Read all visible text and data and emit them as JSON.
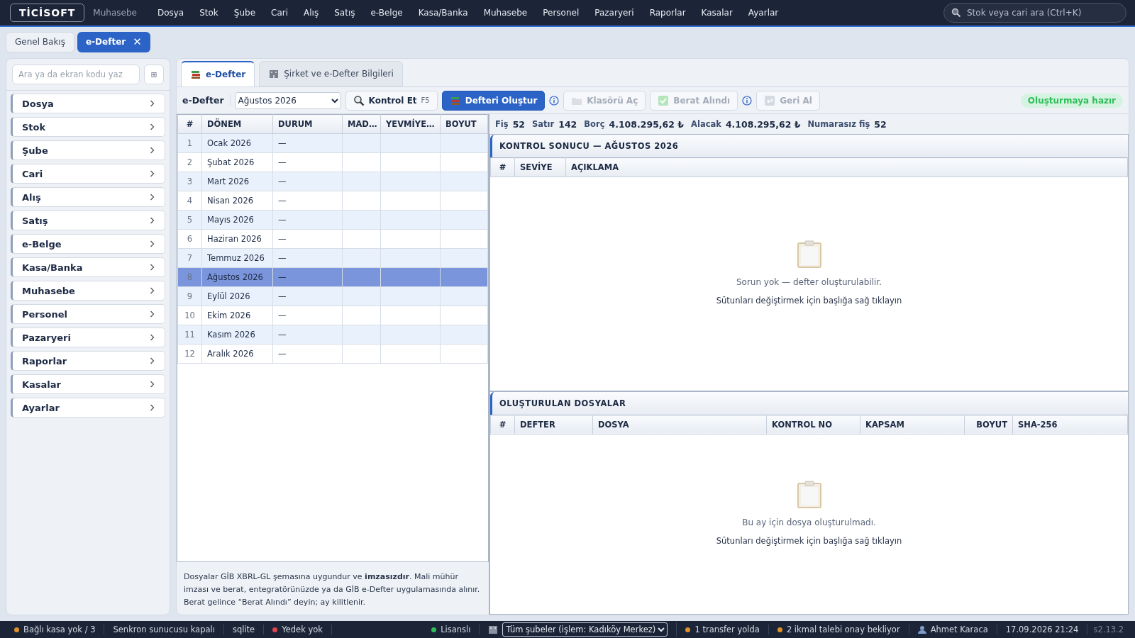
{
  "topbar": {
    "logo": "TİCİSOFT",
    "module": "Muhasebe",
    "menu": [
      "Dosya",
      "Stok",
      "Şube",
      "Cari",
      "Alış",
      "Satış",
      "e-Belge",
      "Kasa/Banka",
      "Muhasebe",
      "Personel",
      "Pazaryeri",
      "Raporlar",
      "Kasalar",
      "Ayarlar"
    ],
    "search": {
      "placeholder": "Stok veya cari ara (Ctrl+K)"
    }
  },
  "page_tabs": [
    {
      "label": "Genel Bakış",
      "selected": false
    },
    {
      "label": "e-Defter",
      "selected": true,
      "close": "✕"
    }
  ],
  "sidebar": {
    "search": {
      "placeholder": "Ara ya da ekran kodu yaz"
    },
    "grid_button": "⊞",
    "items": [
      "Dosya",
      "Stok",
      "Şube",
      "Cari",
      "Alış",
      "Satış",
      "e-Belge",
      "Kasa/Banka",
      "Muhasebe",
      "Personel",
      "Pazaryeri",
      "Raporlar",
      "Kasalar",
      "Ayarlar"
    ]
  },
  "inner_tabs": [
    {
      "label": "e-Defter",
      "selected": true
    },
    {
      "label": "Şirket ve e-Defter Bilgileri",
      "selected": false
    }
  ],
  "toolbar": {
    "title": "e-Defter",
    "period": "Ağustos 2026",
    "buttons": [
      {
        "label": "Kontrol Et",
        "shortcut": "F5",
        "kind": "normal",
        "disabled": false,
        "info": false
      },
      {
        "label": "Defteri Oluştur",
        "kind": "primary",
        "disabled": false,
        "info": true
      },
      {
        "label": "Klasörü Aç",
        "kind": "normal",
        "disabled": true,
        "info": false
      },
      {
        "label": "Berat Alındı",
        "kind": "normal",
        "disabled": true,
        "info": true
      },
      {
        "label": "Geri Al",
        "kind": "normal",
        "disabled": true,
        "info": false
      }
    ],
    "status": "Oluşturmaya hazır"
  },
  "periods_table": {
    "columns": [
      "#",
      "DÖNEM",
      "DURUM",
      "MAD…",
      "YEVMİYE…",
      "BOYUT"
    ],
    "rows": [
      {
        "no": "1",
        "period": "Ocak 2026",
        "status": "—",
        "selected": false
      },
      {
        "no": "2",
        "period": "Şubat 2026",
        "status": "—",
        "selected": false
      },
      {
        "no": "3",
        "period": "Mart 2026",
        "status": "—",
        "selected": false
      },
      {
        "no": "4",
        "period": "Nisan 2026",
        "status": "—",
        "selected": false
      },
      {
        "no": "5",
        "period": "Mayıs 2026",
        "status": "—",
        "selected": false
      },
      {
        "no": "6",
        "period": "Haziran 2026",
        "status": "—",
        "selected": false
      },
      {
        "no": "7",
        "period": "Temmuz 2026",
        "status": "—",
        "selected": false
      },
      {
        "no": "8",
        "period": "Ağustos 2026",
        "status": "—",
        "selected": true
      },
      {
        "no": "9",
        "period": "Eylül 2026",
        "status": "—",
        "selected": false
      },
      {
        "no": "10",
        "period": "Ekim 2026",
        "status": "—",
        "selected": false
      },
      {
        "no": "11",
        "period": "Kasım 2026",
        "status": "—",
        "selected": false
      },
      {
        "no": "12",
        "period": "Aralık 2026",
        "status": "—",
        "selected": false
      }
    ]
  },
  "note": "Dosyalar GİB XBRL-GL şemasına uygundur ve **imzasızdır**. Mali mühür imzası ve berat, entegratörünüzde ya da GİB e-Defter uygulamasında alınır. Berat gelince “Berat Alındı” deyin; ay kilitlenir.",
  "summary": [
    {
      "label": "Fiş",
      "value": "52"
    },
    {
      "label": "Satır",
      "value": "142"
    },
    {
      "label": "Borç",
      "value": "4.108.295,62 ₺"
    },
    {
      "label": "Alacak",
      "value": "4.108.295,62 ₺"
    },
    {
      "label": "Numarasız fiş",
      "value": "52"
    }
  ],
  "control_panel": {
    "title": "KONTROL SONUCU — AĞUSTOS 2026",
    "columns": [
      "#",
      "SEVİYE",
      "AÇIKLAMA"
    ],
    "empty": "Sorun yok — defter oluşturulabilir.",
    "hint": "Sütunları değiştirmek için başlığa sağ tıklayın"
  },
  "files_panel": {
    "title": "OLUŞTURULAN DOSYALAR",
    "columns": [
      "#",
      "DEFTER",
      "DOSYA",
      "KONTROL NO",
      "KAPSAM",
      "BOYUT",
      "SHA-256"
    ],
    "empty": "Bu ay için dosya oluşturulmadı.",
    "hint": "Sütunları değiştirmek için başlığa sağ tıklayın"
  },
  "status_bar": {
    "left": [
      {
        "text": "Bağlı kasa yok / 3",
        "color": "#e0922a"
      },
      {
        "text": "Senkron sunucusu kapalı"
      },
      {
        "text": "sqlite"
      },
      {
        "text": "Yedek yok",
        "color": "#e0454f"
      }
    ],
    "license": {
      "text": "Lisanslı",
      "color": "#2fbf5a"
    },
    "branch": "Tüm şubeler (işlem: Kadıköy Merkez)",
    "right": [
      {
        "text": "1 transfer yolda",
        "color": "#e0922a"
      },
      {
        "text": "2 ikmal talebi onay bekliyor",
        "color": "#e0922a"
      }
    ],
    "user": "Ahmet Karaca",
    "datetime": "17.09.2026 21:24",
    "version": "s2.13.2"
  }
}
